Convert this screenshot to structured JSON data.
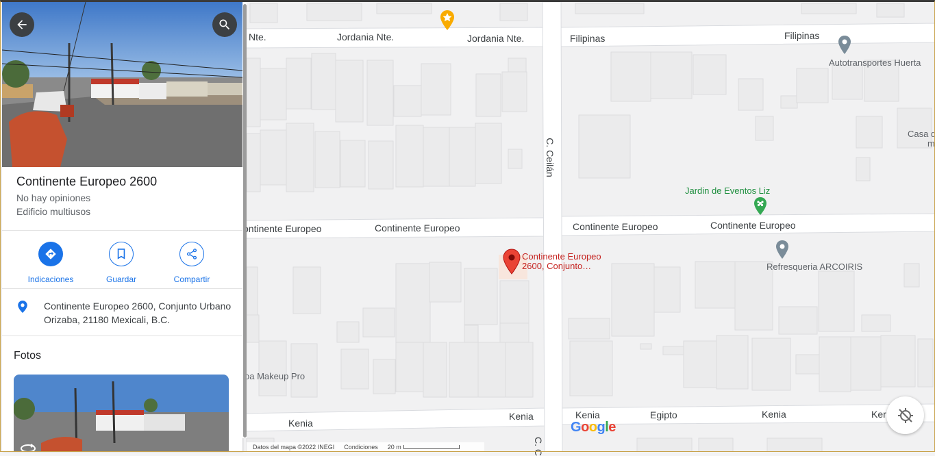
{
  "place": {
    "name": "Continente Europeo 2600",
    "reviews": "No hay opiniones",
    "category": "Edificio multiusos",
    "address_line1": "Continente Europeo 2600, Conjunto Urbano",
    "address_line2": "Orizaba, 21180 Mexicali, B.C."
  },
  "actions": {
    "directions": "Indicaciones",
    "save": "Guardar",
    "share": "Compartir"
  },
  "photos_heading": "Fotos",
  "map": {
    "streets": {
      "jordania_left": "Nte.",
      "jordania_1": "Jordania Nte.",
      "jordania_2": "Jordania Nte.",
      "filipinas_1": "Filipinas",
      "filipinas_2": "Filipinas",
      "ceilan": "C. Ceilán",
      "ceilan_bottom": "C. C",
      "continente_1": "ontinente Europeo",
      "continente_2": "Continente Europeo",
      "continente_3": "Continente Europeo",
      "continente_4": "Continente Europeo",
      "kenia_1": "Kenia",
      "kenia_2": "Kenia",
      "kenia_3": "Kenia",
      "kenia_4": "Kenia",
      "kenia_5": "Ker",
      "egipto": "Egipto"
    },
    "pois": {
      "autotransportes": "Autotransportes Huerta",
      "casa_1": "Casa d",
      "casa_2": "m",
      "jardin": "Jardin de Eventos Liz",
      "refresqueria": "Refresqueria ARCOIRIS",
      "makeup": "oa Makeup Pro"
    },
    "pin_label_1": "Continente Europeo",
    "pin_label_2": "2600, Conjunto…",
    "footer": {
      "data": "Datos del mapa ©2022 INEGI",
      "terms": "Condiciones",
      "scale": "20 m"
    },
    "logo": "Google",
    "colors": {
      "pin": "#ea4335",
      "accent": "#1a73e8",
      "park": "#34a853",
      "gold": "#f9ab00"
    }
  },
  "icons": [
    "back-arrow-icon",
    "search-icon",
    "directions-icon",
    "bookmark-icon",
    "share-icon",
    "location-pin-icon",
    "street-view-icon",
    "locate-off-icon"
  ]
}
